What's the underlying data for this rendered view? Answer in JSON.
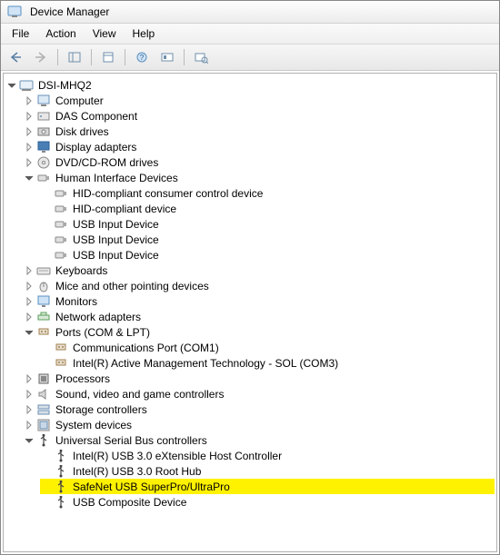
{
  "window": {
    "title": "Device Manager"
  },
  "menu": {
    "file": "File",
    "action": "Action",
    "view": "View",
    "help": "Help"
  },
  "tree": {
    "root": "DSI-MHQ2",
    "nodes": [
      {
        "label": "Computer",
        "expanded": false,
        "icon": "computer"
      },
      {
        "label": "DAS Component",
        "expanded": false,
        "icon": "das"
      },
      {
        "label": "Disk drives",
        "expanded": false,
        "icon": "disk"
      },
      {
        "label": "Display adapters",
        "expanded": false,
        "icon": "display"
      },
      {
        "label": "DVD/CD-ROM drives",
        "expanded": false,
        "icon": "dvd"
      },
      {
        "label": "Human Interface Devices",
        "expanded": true,
        "icon": "hid",
        "children": [
          {
            "label": "HID-compliant consumer control device",
            "icon": "hid"
          },
          {
            "label": "HID-compliant device",
            "icon": "hid"
          },
          {
            "label": "USB Input Device",
            "icon": "hid"
          },
          {
            "label": "USB Input Device",
            "icon": "hid"
          },
          {
            "label": "USB Input Device",
            "icon": "hid"
          }
        ]
      },
      {
        "label": "Keyboards",
        "expanded": false,
        "icon": "keyboard"
      },
      {
        "label": "Mice and other pointing devices",
        "expanded": false,
        "icon": "mouse"
      },
      {
        "label": "Monitors",
        "expanded": false,
        "icon": "monitor"
      },
      {
        "label": "Network adapters",
        "expanded": false,
        "icon": "network"
      },
      {
        "label": "Ports (COM & LPT)",
        "expanded": true,
        "icon": "port",
        "children": [
          {
            "label": "Communications Port (COM1)",
            "icon": "port"
          },
          {
            "label": "Intel(R) Active Management Technology - SOL (COM3)",
            "icon": "port"
          }
        ]
      },
      {
        "label": "Processors",
        "expanded": false,
        "icon": "cpu"
      },
      {
        "label": "Sound, video and game controllers",
        "expanded": false,
        "icon": "sound"
      },
      {
        "label": "Storage controllers",
        "expanded": false,
        "icon": "storage"
      },
      {
        "label": "System devices",
        "expanded": false,
        "icon": "system"
      },
      {
        "label": "Universal Serial Bus controllers",
        "expanded": true,
        "icon": "usb",
        "children": [
          {
            "label": "Intel(R) USB 3.0 eXtensible Host Controller",
            "icon": "usb"
          },
          {
            "label": "Intel(R) USB 3.0 Root Hub",
            "icon": "usb"
          },
          {
            "label": "SafeNet USB SuperPro/UltraPro",
            "icon": "usb",
            "highlight": true
          },
          {
            "label": "USB Composite Device",
            "icon": "usb"
          }
        ]
      }
    ]
  }
}
